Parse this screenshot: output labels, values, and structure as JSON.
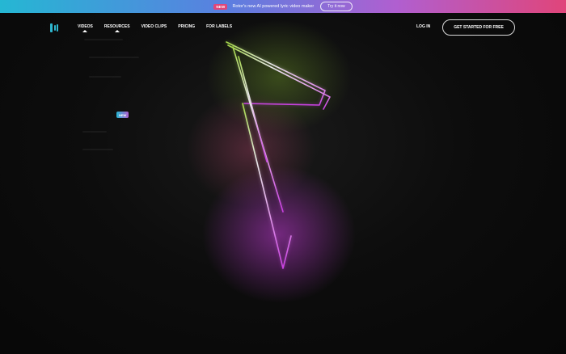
{
  "banner": {
    "badge": "NEW",
    "text": "Rotor's new AI powered lyric video maker",
    "cta": "Try it now"
  },
  "nav": {
    "links": [
      "VIDEOS",
      "RESOURCES",
      "VIDEO CLIPS",
      "PRICING",
      "FOR LABELS"
    ],
    "login": "LOG IN",
    "cta": "GET STARTED FOR FREE"
  },
  "menu": {
    "new_badge": "NEW"
  },
  "colors": {
    "accent": "#2fb7cf",
    "banner_gradient": [
      "#25b7d3",
      "#b05fd0",
      "#e0457a"
    ],
    "neon_green": "#9acd32",
    "neon_magenta": "#c23bd6"
  }
}
